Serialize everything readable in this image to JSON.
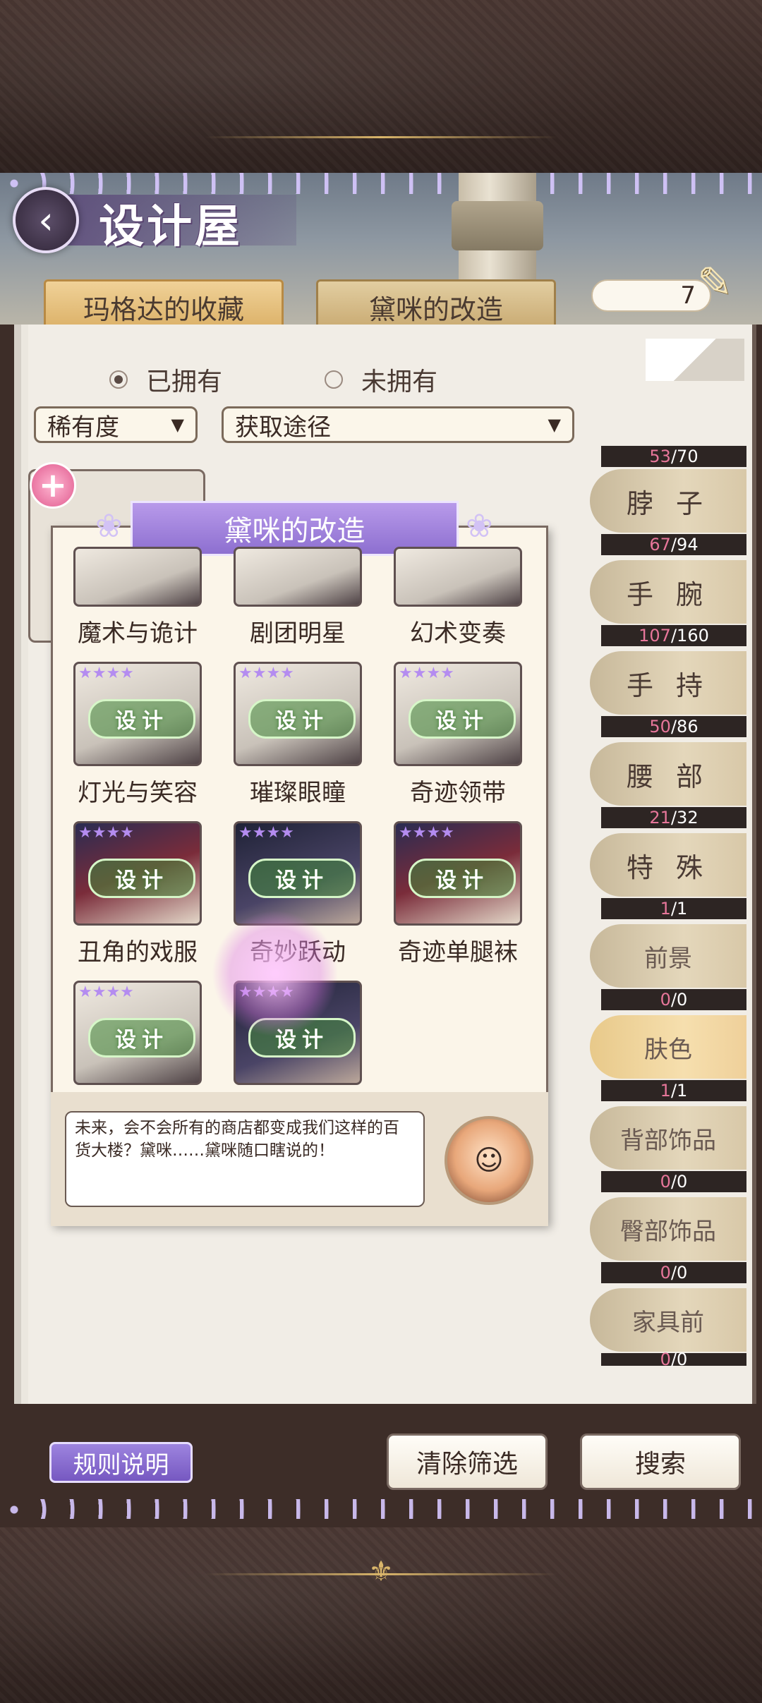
{
  "header": {
    "title": "设计屋",
    "back_icon": "chevron-left-icon",
    "tabs": [
      {
        "label": "玛格达的收藏",
        "active": true
      },
      {
        "label": "黛咪的改造",
        "active": false
      }
    ],
    "counter_value": "7",
    "counter_icon": "quill-scroll-icon"
  },
  "filters": {
    "radio": [
      {
        "label": "已拥有",
        "selected": true
      },
      {
        "label": "未拥有",
        "selected": false
      }
    ],
    "rarity_select": "稀有度",
    "source_select": "获取途径"
  },
  "categories": [
    {
      "label": "",
      "owned": "53",
      "total": "70"
    },
    {
      "label": "脖 子",
      "owned": "67",
      "total": "94"
    },
    {
      "label": "手 腕",
      "owned": "107",
      "total": "160"
    },
    {
      "label": "手 持",
      "owned": "50",
      "total": "86"
    },
    {
      "label": "腰 部",
      "owned": "21",
      "total": "32"
    },
    {
      "label": "特 殊",
      "owned": "1",
      "total": "1"
    },
    {
      "label": "前景",
      "owned": "0",
      "total": "0"
    },
    {
      "label": "肤色",
      "owned": "1",
      "total": "1",
      "active": true
    },
    {
      "label": "背部饰品",
      "owned": "0",
      "total": "0"
    },
    {
      "label": "臀部饰品",
      "owned": "0",
      "total": "0"
    },
    {
      "label": "家具前",
      "owned": "0",
      "total": "0"
    }
  ],
  "popup": {
    "title": "黛咪的改造",
    "design_label": "设计",
    "items": [
      {
        "name": "魔术与诡计"
      },
      {
        "name": "剧团明星"
      },
      {
        "name": "幻术变奏"
      },
      {
        "name": "灯光与笑容"
      },
      {
        "name": "璀璨眼瞳"
      },
      {
        "name": "奇迹领带"
      },
      {
        "name": "丑角的戏服"
      },
      {
        "name": "奇妙跃动"
      },
      {
        "name": "奇迹单腿袜"
      },
      {
        "name": ""
      },
      {
        "name": ""
      }
    ],
    "dialog_text": "未来，会不会所有的商店都变成我们这样的百货大楼？黛咪……黛咪随口瞎说的！"
  },
  "footer": {
    "rules_label": "规则说明",
    "clear_label": "清除筛选",
    "search_label": "搜索"
  },
  "colors": {
    "accent_purple": "#8d6fd0",
    "tab_gold": "#d9ad62",
    "owned_count": "#e7769a"
  }
}
